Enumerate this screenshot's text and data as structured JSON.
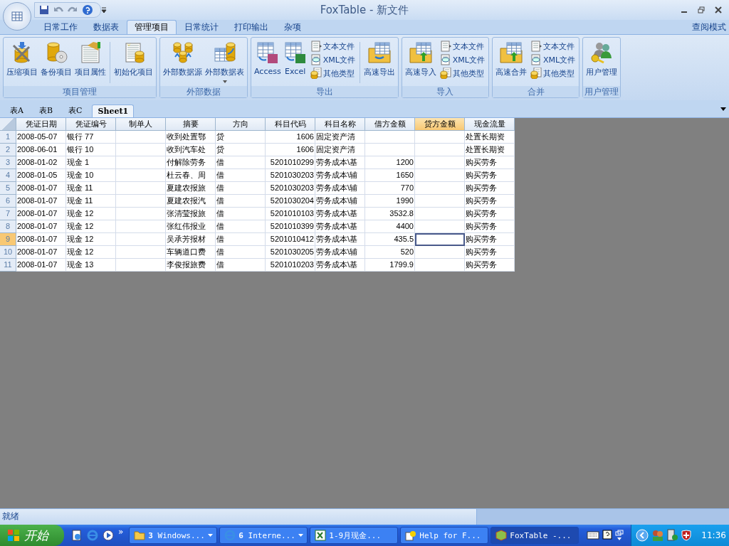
{
  "window": {
    "title": "FoxTable - 新文件"
  },
  "ribbon": {
    "tabs": [
      {
        "label": "日常工作",
        "selected": false
      },
      {
        "label": "数据表",
        "selected": false
      },
      {
        "label": "管理项目",
        "selected": true
      },
      {
        "label": "日常统计",
        "selected": false
      },
      {
        "label": "打印输出",
        "selected": false
      },
      {
        "label": "杂项",
        "selected": false
      }
    ],
    "mode_label": "查阅模式",
    "groups": [
      {
        "label": "项目管理",
        "items": [
          {
            "kind": "large",
            "label": "压缩项目"
          },
          {
            "kind": "large",
            "label": "备份项目"
          },
          {
            "kind": "large",
            "label": "项目属性"
          },
          {
            "kind": "separator"
          },
          {
            "kind": "large",
            "label": "初始化项目"
          }
        ]
      },
      {
        "label": "外部数据",
        "items": [
          {
            "kind": "large",
            "label": "外部数据源"
          },
          {
            "kind": "large",
            "label": "外部数据表",
            "dropdown": true
          }
        ]
      },
      {
        "label": "导出",
        "items": [
          {
            "kind": "large",
            "label": "Access"
          },
          {
            "kind": "large",
            "label": "Excel"
          },
          {
            "kind": "stack",
            "items": [
              "文本文件",
              "XML文件",
              "其他类型"
            ]
          },
          {
            "kind": "separator"
          },
          {
            "kind": "large",
            "label": "高速导出"
          }
        ]
      },
      {
        "label": "导入",
        "items": [
          {
            "kind": "large",
            "label": "高速导入"
          },
          {
            "kind": "stack",
            "items": [
              "文本文件",
              "XML文件",
              "其他类型"
            ]
          }
        ]
      },
      {
        "label": "合并",
        "items": [
          {
            "kind": "large",
            "label": "高速合并"
          },
          {
            "kind": "stack",
            "items": [
              "文本文件",
              "XML文件",
              "其他类型"
            ]
          }
        ]
      },
      {
        "label": "用户管理",
        "items": [
          {
            "kind": "large",
            "label": "用户管理"
          }
        ]
      }
    ]
  },
  "sheet_tabs": [
    {
      "label": "表A",
      "selected": false
    },
    {
      "label": "表B",
      "selected": false
    },
    {
      "label": "表C",
      "selected": false
    },
    {
      "label": "Sheet1",
      "selected": true
    }
  ],
  "table": {
    "columns": [
      {
        "label": "凭证日期",
        "selected": false
      },
      {
        "label": "凭证编号",
        "selected": false
      },
      {
        "label": "制单人",
        "selected": false
      },
      {
        "label": "摘要",
        "selected": false
      },
      {
        "label": "方向",
        "selected": false
      },
      {
        "label": "科目代码",
        "selected": false
      },
      {
        "label": "科目名称",
        "selected": false
      },
      {
        "label": "借方金额",
        "selected": false
      },
      {
        "label": "贷方金额",
        "selected": true
      },
      {
        "label": "现金流量",
        "selected": false
      }
    ],
    "rows": [
      {
        "number": "1",
        "selected": false,
        "cells": [
          "2008-05-07",
          "银行 77",
          null,
          "收到处置鄂",
          "贷",
          "1606",
          "固定资产清",
          null,
          null,
          "处置长期资"
        ]
      },
      {
        "number": "2",
        "selected": false,
        "cells": [
          "2008-06-01",
          "银行 10",
          null,
          "收到汽车处",
          "贷",
          "1606",
          "固定资产清",
          null,
          null,
          "处置长期资"
        ]
      },
      {
        "number": "3",
        "selected": false,
        "cells": [
          "2008-01-02",
          "现金 1",
          null,
          "付解除劳务",
          "借",
          "5201010299",
          "劳务成本\\基",
          "1200",
          null,
          "购买劳务"
        ]
      },
      {
        "number": "4",
        "selected": false,
        "cells": [
          "2008-01-05",
          "现金 10",
          null,
          "杜云春、周",
          "借",
          "5201030203",
          "劳务成本\\辅",
          "1650",
          null,
          "购买劳务"
        ]
      },
      {
        "number": "5",
        "selected": false,
        "cells": [
          "2008-01-07",
          "现金 11",
          null,
          "夏建农报旅",
          "借",
          "5201030203",
          "劳务成本\\辅",
          "770",
          null,
          "购买劳务"
        ]
      },
      {
        "number": "6",
        "selected": false,
        "cells": [
          "2008-01-07",
          "现金 11",
          null,
          "夏建农报汽",
          "借",
          "5201030204",
          "劳务成本\\辅",
          "1990",
          null,
          "购买劳务"
        ]
      },
      {
        "number": "7",
        "selected": false,
        "cells": [
          "2008-01-07",
          "现金 12",
          null,
          "张清莹报旅",
          "借",
          "5201010103",
          "劳务成本\\基",
          "3532.8",
          null,
          "购买劳务"
        ]
      },
      {
        "number": "8",
        "selected": false,
        "cells": [
          "2008-01-07",
          "现金 12",
          null,
          "张红伟报业",
          "借",
          "5201010399",
          "劳务成本\\基",
          "4400",
          null,
          "购买劳务"
        ]
      },
      {
        "number": "9",
        "selected": true,
        "cells": [
          "2008-01-07",
          "现金 12",
          null,
          "吴承芳报材",
          "借",
          "5201010412",
          "劳务成本\\基",
          "435.5",
          null,
          "购买劳务"
        ]
      },
      {
        "number": "10",
        "selected": false,
        "cells": [
          "2008-01-07",
          "现金 12",
          null,
          "车辆道口费",
          "借",
          "5201030205",
          "劳务成本\\辅",
          "520",
          null,
          "购买劳务"
        ]
      },
      {
        "number": "11",
        "selected": false,
        "cells": [
          "2008-01-07",
          "现金 13",
          null,
          "李俊报旅费",
          "借",
          "5201010203",
          "劳务成本\\基",
          "1799.9",
          null,
          "购买劳务"
        ]
      }
    ]
  },
  "status_bar": {
    "text": "就绪"
  },
  "taskbar": {
    "start": "开始",
    "more": "»",
    "tasks": [
      {
        "label": "**3** Windows...",
        "grouped": true,
        "selected": false
      },
      {
        "label": "**6** Interne...",
        "grouped": true,
        "selected": false
      },
      {
        "label": "1-9月现金...",
        "grouped": false,
        "selected": false
      },
      {
        "label": "Help for F...",
        "grouped": false,
        "selected": false
      },
      {
        "label": "FoxTable -...",
        "grouped": false,
        "selected": true
      }
    ],
    "clock": "11:36"
  }
}
